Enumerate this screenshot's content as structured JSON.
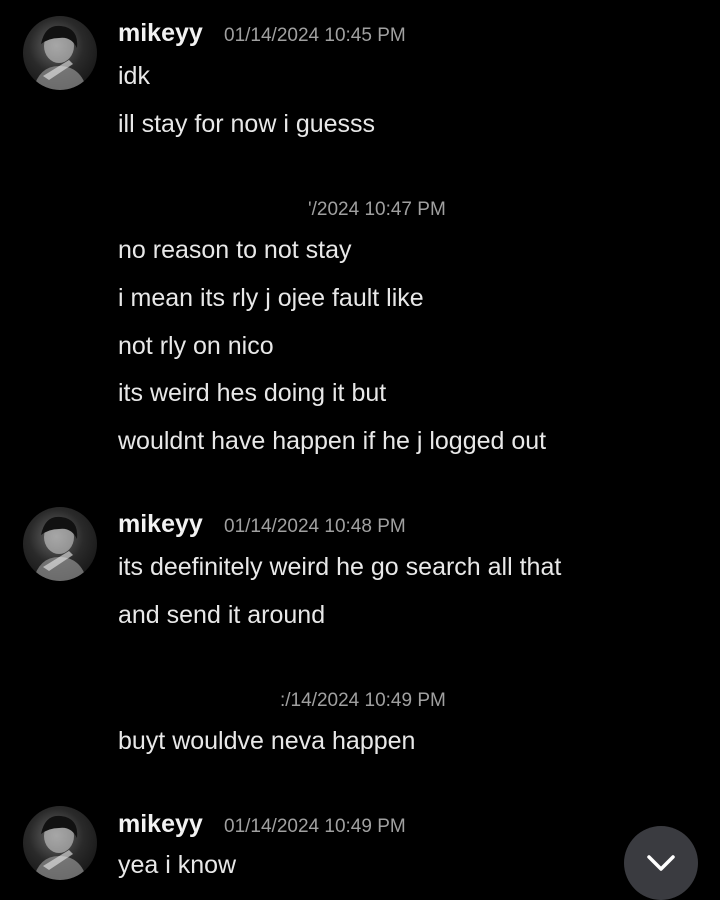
{
  "messages": {
    "group1": {
      "username": "mikeyy",
      "timestamp": "01/14/2024 10:45 PM",
      "lines": [
        "idk",
        "ill stay for now i guesss"
      ]
    },
    "group2": {
      "timestamp": "'/2024 10:47 PM",
      "lines": [
        "no reason to not stay",
        "i mean its rly j ojee fault like",
        "not rly on nico",
        "its weird hes doing it but",
        "wouldnt have happen if he j logged out"
      ]
    },
    "group3": {
      "username": "mikeyy",
      "timestamp": "01/14/2024 10:48 PM",
      "lines": [
        "its deefinitely weird he go search all that",
        "and send it around"
      ]
    },
    "group4": {
      "timestamp": ":/14/2024 10:49 PM",
      "lines": [
        "buyt wouldve neva happen"
      ]
    },
    "group5": {
      "username": "mikeyy",
      "timestamp": "01/14/2024 10:49 PM",
      "lines": [
        "yea i know"
      ]
    }
  },
  "scroll_button": {
    "icon": "chevron-down-icon"
  },
  "colors": {
    "background": "#000000",
    "username": "#f2f2f2",
    "text": "#e8e8e8",
    "timestamp": "#a0a0a0",
    "scroll_button": "#3a3b40"
  }
}
